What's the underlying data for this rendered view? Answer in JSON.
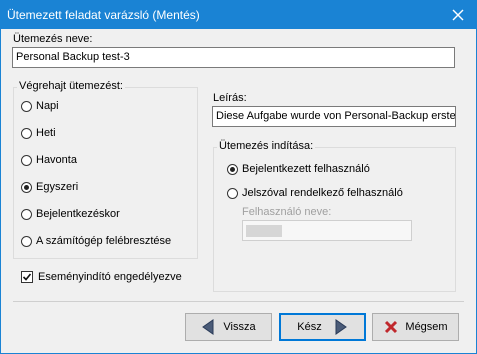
{
  "window": {
    "title": "Ütemezett feladat varázsló (Mentés)",
    "close_icon": "close-icon",
    "accent": "#1a83d4"
  },
  "schedule_name": {
    "label": "Ütemezés neve:",
    "value": "Personal Backup test-3"
  },
  "execute_group": {
    "legend": "Végrehajt ütemezést:",
    "options": [
      {
        "label": "Napi",
        "selected": false
      },
      {
        "label": "Heti",
        "selected": false
      },
      {
        "label": "Havonta",
        "selected": false
      },
      {
        "label": "Egyszeri",
        "selected": true
      },
      {
        "label": "Bejelentkezéskor",
        "selected": false
      },
      {
        "label": "A számítógép felébresztése",
        "selected": false
      }
    ]
  },
  "description": {
    "label": "Leírás:",
    "value": "Diese Aufgabe wurde von Personal-Backup erstel"
  },
  "start_group": {
    "legend": "Ütemezés indítása:",
    "options": [
      {
        "label": "Bejelentkezett felhasználó",
        "selected": true
      },
      {
        "label": "Jelszóval rendelkező felhasználó",
        "selected": false
      }
    ],
    "username_label": "Felhasználó neve:",
    "username_value": ""
  },
  "event_trigger": {
    "label": "Eseményindító engedélyezve",
    "checked": true
  },
  "buttons": {
    "back": {
      "label": "Vissza",
      "icon": "arrow-left-icon"
    },
    "finish": {
      "label": "Kész",
      "icon": "arrow-right-icon"
    },
    "cancel": {
      "label": "Mégsem",
      "icon": "red-x-icon"
    }
  }
}
